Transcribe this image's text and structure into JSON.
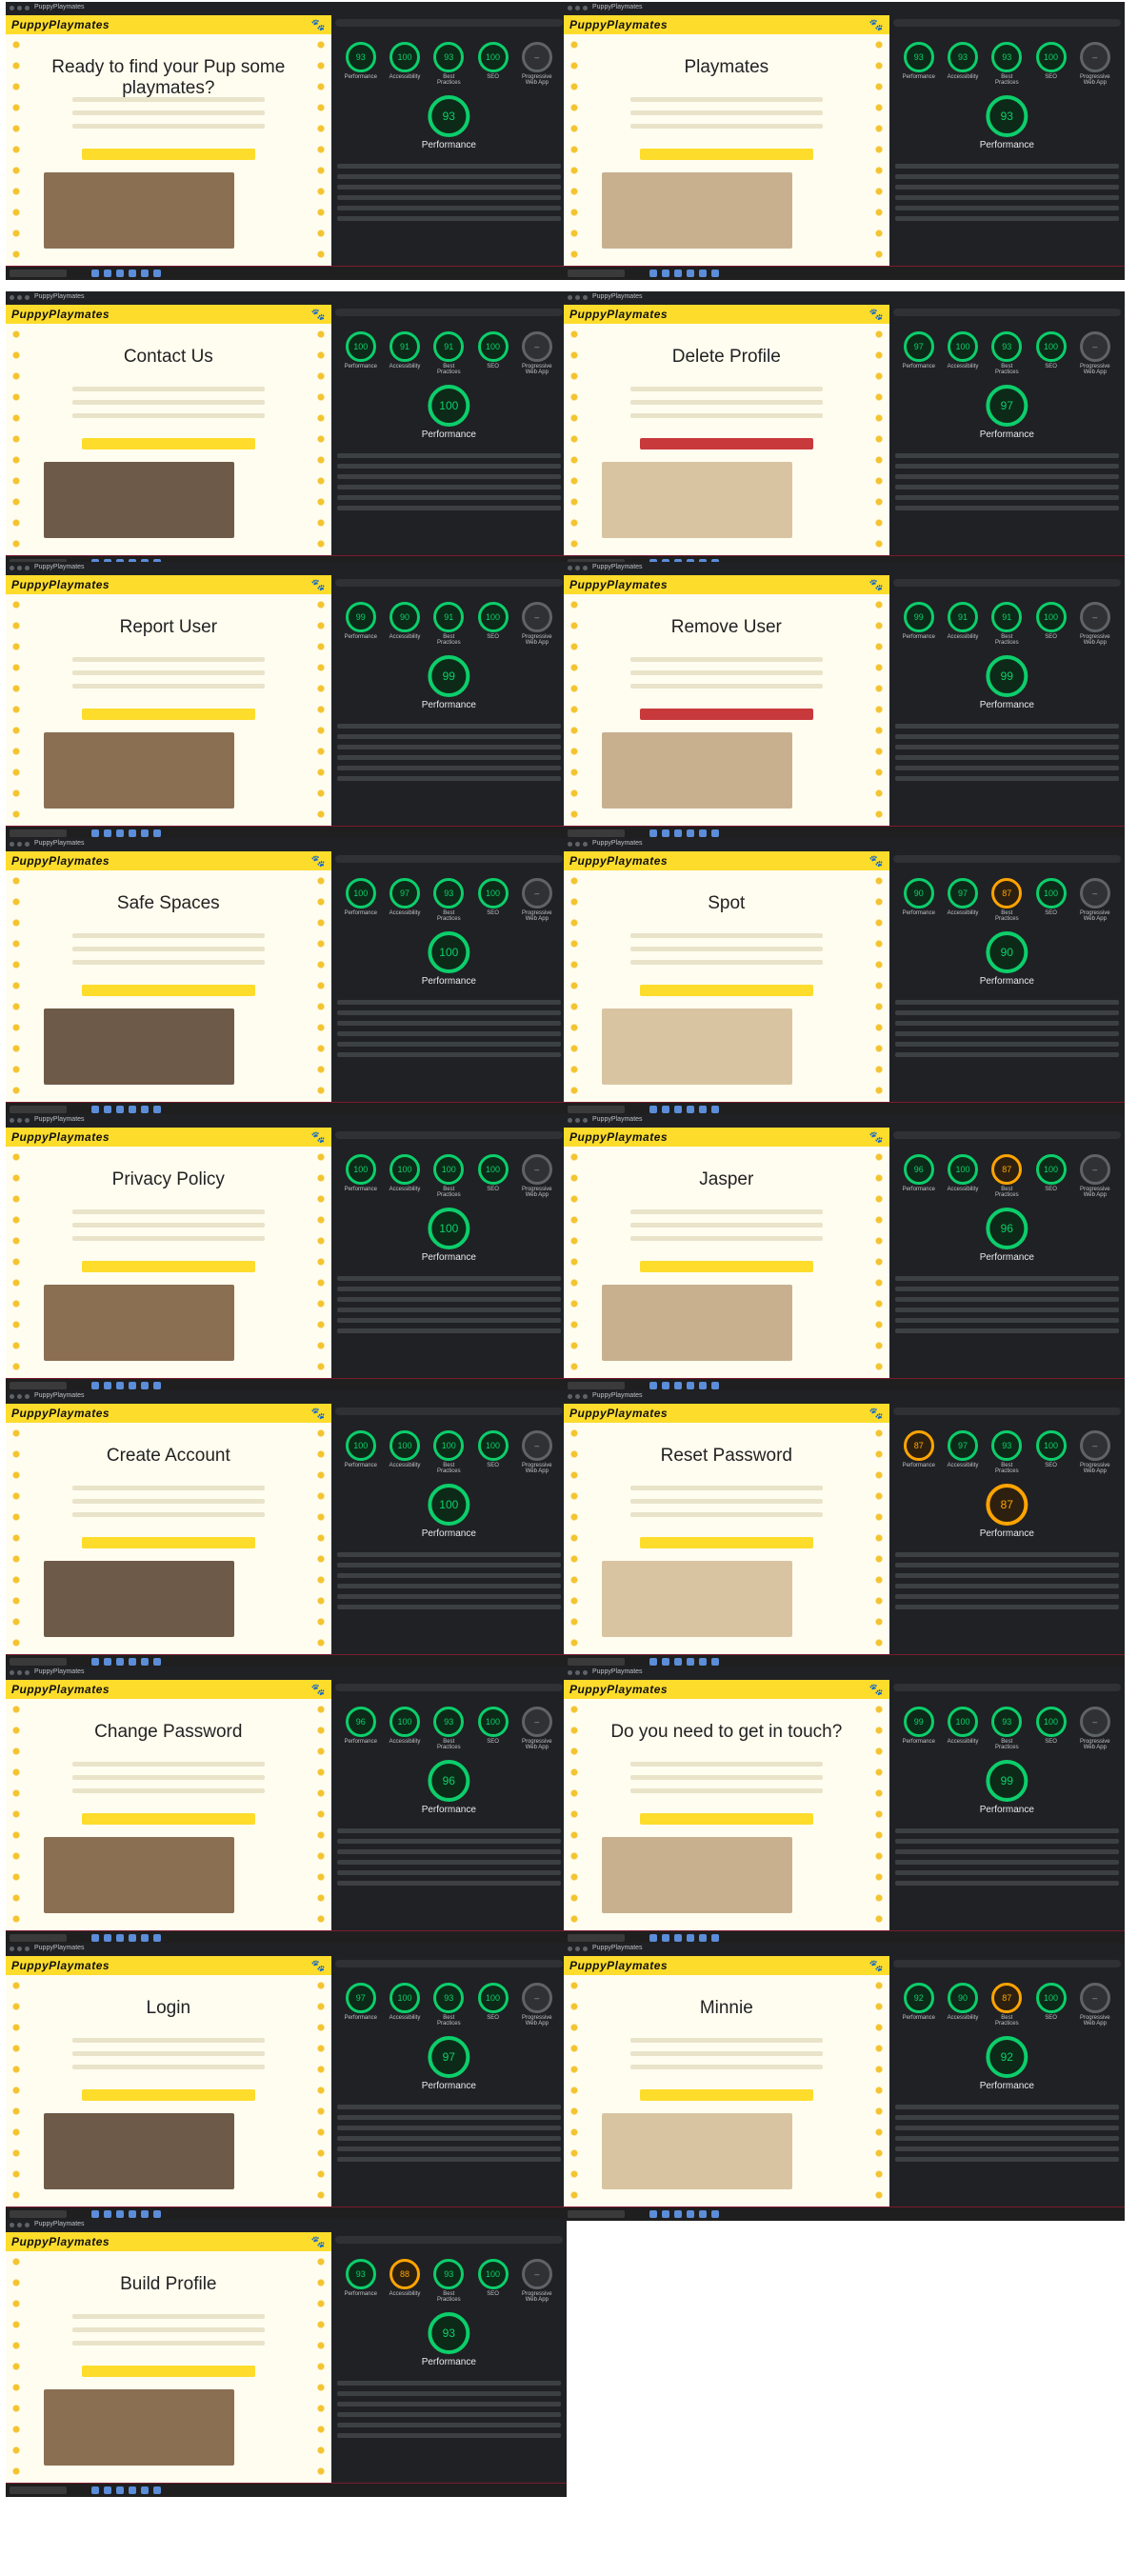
{
  "brand": "PuppyPlaymates",
  "colors": {
    "brand_yellow": "#fddc2b",
    "pass_green": "#0cce6b",
    "avg_orange": "#ffa400",
    "danger_red": "#c8393c",
    "devtools_bg": "#202124"
  },
  "lighthouse": {
    "performance_label": "Performance"
  },
  "tiles": [
    {
      "page_title": "Ready to find your Pup some playmates?",
      "scores": [
        "93",
        "100",
        "93",
        "100",
        "PWA"
      ],
      "perf": "93"
    },
    {
      "page_title": "Playmates",
      "scores": [
        "93",
        "93",
        "93",
        "100",
        "PWA"
      ],
      "perf": "93"
    },
    {
      "page_title": "Contact Us",
      "scores": [
        "100",
        "91",
        "91",
        "100",
        "PWA"
      ],
      "perf": "100"
    },
    {
      "page_title": "Delete Profile",
      "scores": [
        "97",
        "100",
        "93",
        "100",
        "PWA"
      ],
      "perf": "97"
    },
    {
      "page_title": "Report User",
      "scores": [
        "99",
        "90",
        "91",
        "100",
        "PWA"
      ],
      "perf": "99"
    },
    {
      "page_title": "Remove User",
      "scores": [
        "99",
        "91",
        "91",
        "100",
        "PWA"
      ],
      "perf": "99"
    },
    {
      "page_title": "Safe Spaces",
      "scores": [
        "100",
        "97",
        "93",
        "100",
        "PWA"
      ],
      "perf": "100"
    },
    {
      "page_title": "Spot",
      "scores": [
        "90",
        "97",
        "87",
        "100",
        "PWA"
      ],
      "perf": "90"
    },
    {
      "page_title": "Privacy Policy",
      "scores": [
        "100",
        "100",
        "100",
        "100",
        "PWA"
      ],
      "perf": "100"
    },
    {
      "page_title": "Jasper",
      "scores": [
        "96",
        "100",
        "87",
        "100",
        "PWA"
      ],
      "perf": "96"
    },
    {
      "page_title": "Create Account",
      "scores": [
        "100",
        "100",
        "100",
        "100",
        "PWA"
      ],
      "perf": "100"
    },
    {
      "page_title": "Reset Password",
      "scores": [
        "87",
        "97",
        "93",
        "100",
        "PWA"
      ],
      "perf": "87"
    },
    {
      "page_title": "Change Password",
      "scores": [
        "96",
        "100",
        "93",
        "100",
        "PWA"
      ],
      "perf": "96"
    },
    {
      "page_title": "Do you need to get in touch?",
      "scores": [
        "99",
        "100",
        "93",
        "100",
        "PWA"
      ],
      "perf": "99"
    },
    {
      "page_title": "Login",
      "scores": [
        "97",
        "100",
        "93",
        "100",
        "PWA"
      ],
      "perf": "97"
    },
    {
      "page_title": "Minnie",
      "scores": [
        "92",
        "90",
        "87",
        "100",
        "PWA"
      ],
      "perf": "92"
    },
    {
      "page_title": "Build Profile",
      "scores": [
        "93",
        "88",
        "93",
        "100",
        "PWA"
      ],
      "perf": "93"
    }
  ],
  "score_labels": [
    "Performance",
    "Accessibility",
    "Best Practices",
    "SEO",
    "Progressive Web App"
  ]
}
